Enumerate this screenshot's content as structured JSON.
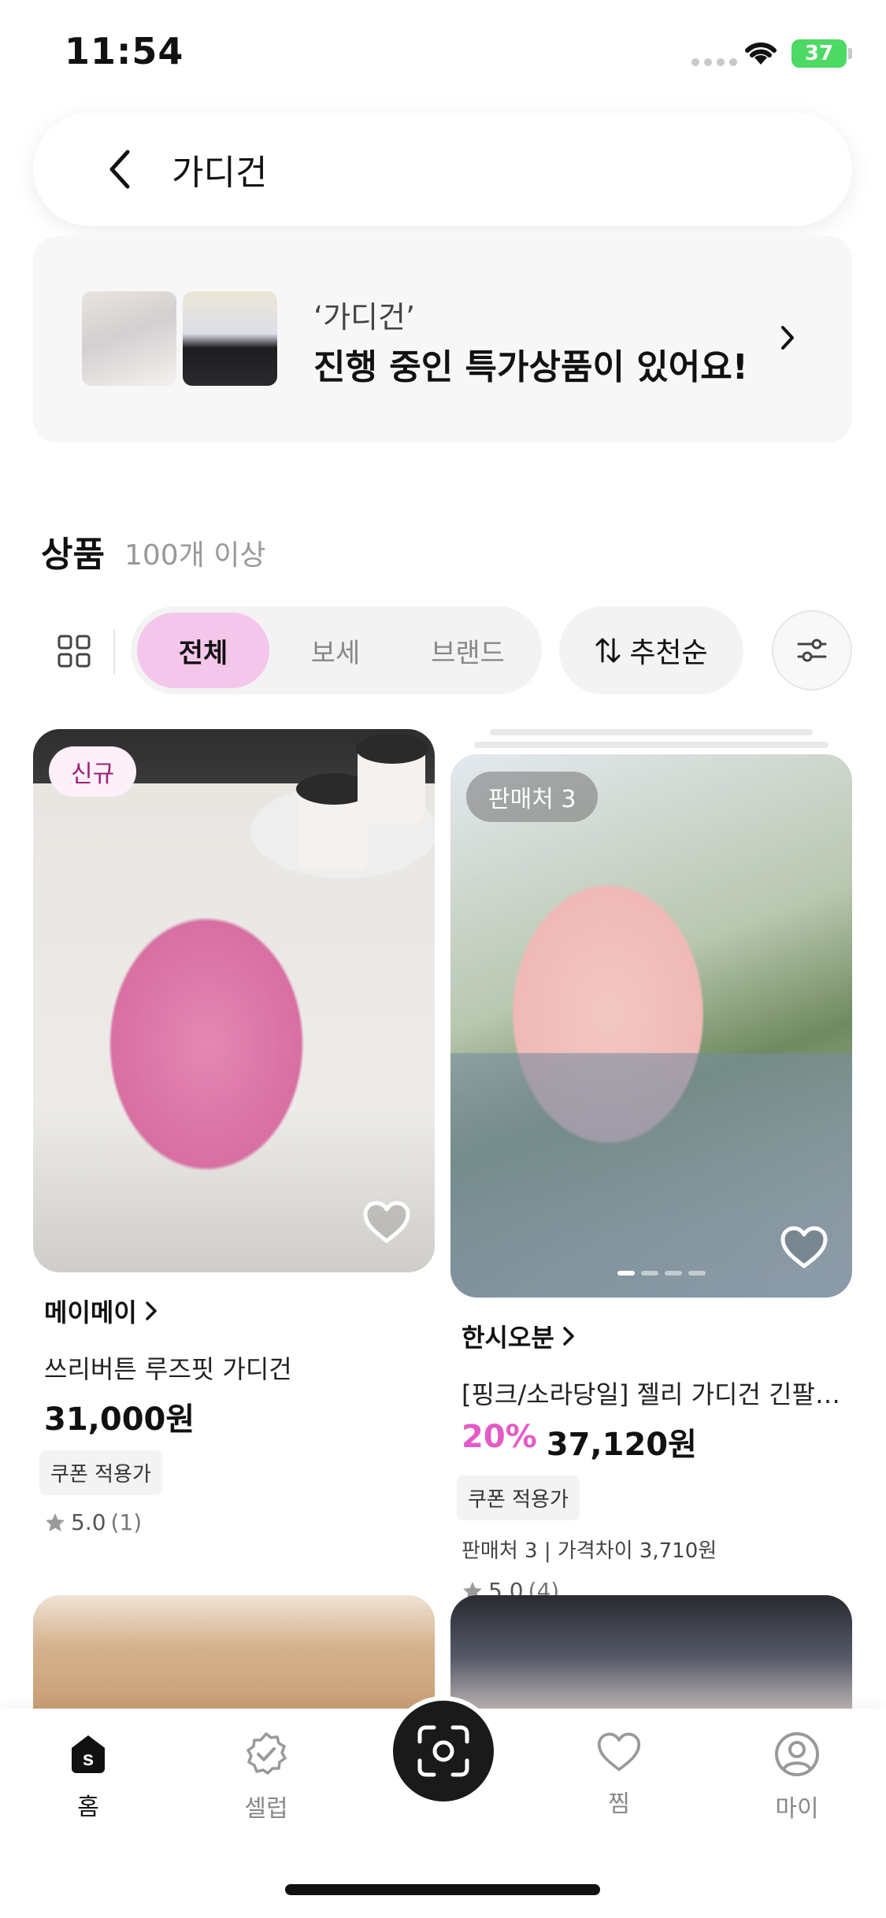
{
  "status": {
    "time": "11:54",
    "battery": "37"
  },
  "search": {
    "query": "가디건"
  },
  "deal_banner": {
    "subtitle": "‘가디건’",
    "title": "진행 중인 특가상품이 있어요!"
  },
  "section": {
    "title": "상품",
    "count": "100개 이상"
  },
  "filters": {
    "all": "전체",
    "bose": "보세",
    "brand": "브랜드",
    "sort": "추천순"
  },
  "products": [
    {
      "badge": "신규",
      "brand": "메이메이",
      "name": "쓰리버튼 루즈핏 가디건",
      "discount": "",
      "price": "31,000원",
      "coupon": "쿠폰 적용가",
      "meta": "",
      "rating": "5.0",
      "review_count": "(1)"
    },
    {
      "badge": "판매처 3",
      "brand": "한시오분",
      "name": "[핑크/소라당일] 젤리 가디건 긴팔 …",
      "discount": "20%",
      "price": "37,120원",
      "coupon": "쿠폰 적용가",
      "meta": "판매처 3 | 가격차이 3,710원",
      "rating": "5.0",
      "review_count": "(4)"
    }
  ],
  "tabs": {
    "home": "홈",
    "celeb": "셀럽",
    "wish": "찜",
    "my": "마이"
  },
  "colors": {
    "accent_pink": "#f5c6ec",
    "discount_pink": "#e35bc7",
    "badge_new_text": "#9c1f79"
  }
}
